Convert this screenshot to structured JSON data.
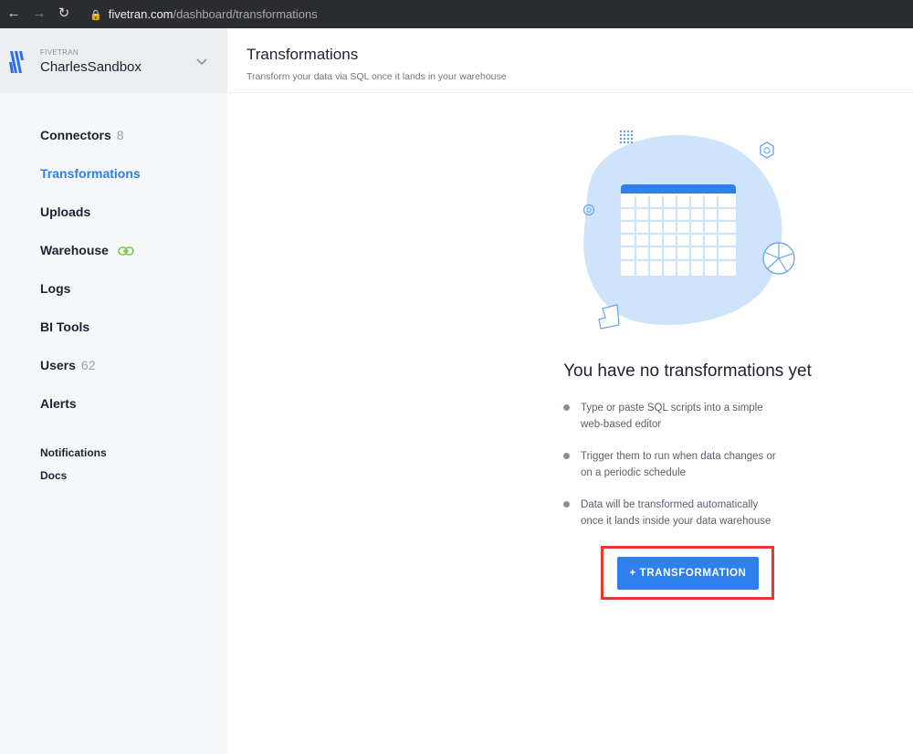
{
  "browser": {
    "back_icon": "arrow-left-icon",
    "forward_icon": "arrow-right-icon",
    "reload_icon": "reload-icon",
    "lock_icon": "lock-icon",
    "url_host": "fivetran.com",
    "url_path": "/dashboard/transformations"
  },
  "account": {
    "kicker": "FIVETRAN",
    "name": "CharlesSandbox"
  },
  "sidebar": {
    "items": [
      {
        "label": "Connectors",
        "count": "8"
      },
      {
        "label": "Transformations"
      },
      {
        "label": "Uploads"
      },
      {
        "label": "Warehouse"
      },
      {
        "label": "Logs"
      },
      {
        "label": "BI Tools"
      },
      {
        "label": "Users",
        "count": "62"
      },
      {
        "label": "Alerts"
      }
    ],
    "secondary": [
      {
        "label": "Notifications"
      },
      {
        "label": "Docs"
      }
    ],
    "active_color": "#2f80e7",
    "warehouse_link_color": "#7ac943"
  },
  "header": {
    "title": "Transformations",
    "subtitle": "Transform your data via SQL once it lands in your warehouse"
  },
  "empty_state": {
    "title": "You have no transformations yet",
    "bullets": [
      {
        "line1": "Type or paste SQL scripts into a simple",
        "line2": "web-based editor"
      },
      {
        "line1": "Trigger them to run when data changes or",
        "line2": "on a periodic schedule"
      },
      {
        "line1": "Data will be transformed automatically",
        "line2": "once it lands inside your data warehouse"
      }
    ],
    "button_label": "+ TRANSFORMATION",
    "button_color": "#2f80ed",
    "highlight_color": "#e53a2a"
  }
}
